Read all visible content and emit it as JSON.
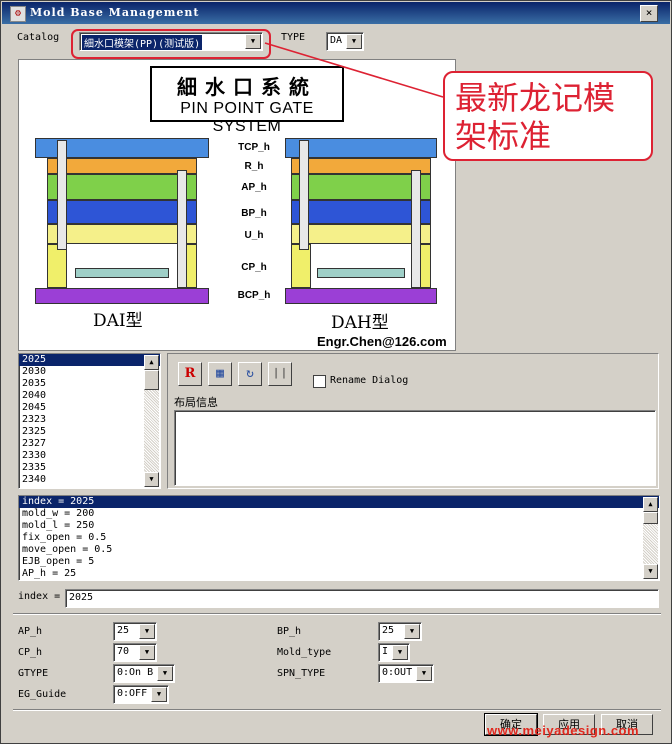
{
  "window": {
    "title": "Mold Base Management",
    "close_glyph": "×",
    "app_icon": "mold-app-icon"
  },
  "catalog": {
    "label": "Catalog",
    "value": "細水口模架(PP)(测试版)"
  },
  "type": {
    "label": "TYPE",
    "value": "DA"
  },
  "annotation": {
    "text": "最新龙记模架标准"
  },
  "diagram": {
    "title_cn": "細水口系統",
    "title_en": "PIN POINT GATE SYSTEM",
    "row_labels": [
      "TCP_h",
      "R_h",
      "AP_h",
      "BP_h",
      "U_h",
      "CP_h",
      "BCP_h"
    ],
    "left_name": "DAI型",
    "right_name": "DAH型",
    "email": "Engr.Chen@126.com",
    "colors": {
      "tcp": "#4a8de0",
      "r": "#f2a93b",
      "ap": "#7fd04a",
      "bp": "#2e55d6",
      "u": "#f5f08a",
      "cp": "#f0ef6a",
      "bcp": "#9b3fd6"
    }
  },
  "size_list": {
    "items": [
      "2025",
      "2030",
      "2035",
      "2040",
      "2045",
      "2323",
      "2325",
      "2327",
      "2330",
      "2335",
      "2340"
    ],
    "selected": "2025"
  },
  "toolbar": {
    "icons": [
      "report-icon",
      "table-icon",
      "refresh-icon",
      "scale-icon"
    ],
    "glyphs": [
      "R",
      "▦",
      "↻",
      "❘❘"
    ]
  },
  "rename_dialog": {
    "label": "Rename Dialog",
    "checked": false
  },
  "layout_info": {
    "label": "布局信息",
    "value": ""
  },
  "param_list": {
    "items": [
      "index = 2025",
      "mold_w = 200",
      "mold_l = 250",
      "fix_open = 0.5",
      "move_open = 0.5",
      "EJB_open = 5",
      "AP_h = 25"
    ],
    "selected": "index = 2025"
  },
  "index_field": {
    "label": "index =",
    "value": "2025"
  },
  "params": {
    "ap_h": {
      "label": "AP_h",
      "value": "25"
    },
    "bp_h": {
      "label": "BP_h",
      "value": "25"
    },
    "cp_h": {
      "label": "CP_h",
      "value": "70"
    },
    "mold_type": {
      "label": "Mold_type",
      "value": "I"
    },
    "gtype": {
      "label": "GTYPE",
      "value": "0:On B"
    },
    "spn_type": {
      "label": "SPN_TYPE",
      "value": "0:OUT"
    },
    "eg_guide": {
      "label": "EG_Guide",
      "value": "0:OFF"
    }
  },
  "buttons": {
    "ok": "确定",
    "apply": "应用",
    "cancel": "取消"
  },
  "watermark": "www.meiyadesign.com",
  "scroll_arrows": {
    "up": "▲",
    "down": "▼"
  }
}
